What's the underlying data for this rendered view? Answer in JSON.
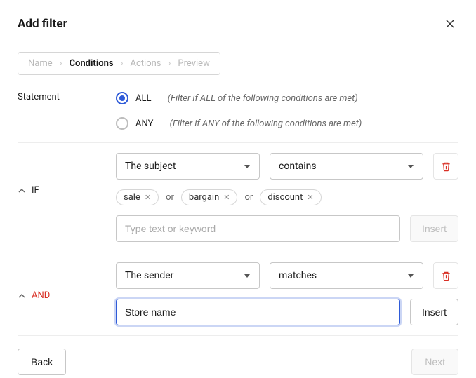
{
  "header": {
    "title": "Add filter"
  },
  "breadcrumb": {
    "steps": [
      "Name",
      "Conditions",
      "Actions",
      "Preview"
    ],
    "active_index": 1
  },
  "statement": {
    "label": "Statement",
    "options": [
      {
        "value": "ALL",
        "desc": "(Filter if ALL of the following conditions are met)",
        "selected": true
      },
      {
        "value": "ANY",
        "desc": "(Filter if ANY of the following conditions are met)",
        "selected": false
      }
    ]
  },
  "conditions": [
    {
      "label": "IF",
      "field": "The subject",
      "operator": "contains",
      "tags": [
        "sale",
        "bargain",
        "discount"
      ],
      "tag_join": "or",
      "input_value": "",
      "input_placeholder": "Type text or keyword",
      "insert_label": "Insert",
      "insert_enabled": false
    },
    {
      "label": "AND",
      "field": "The sender",
      "operator": "matches",
      "input_value": "Store name",
      "insert_label": "Insert",
      "insert_enabled": true,
      "input_focused": true
    }
  ],
  "footer": {
    "back": "Back",
    "next": "Next",
    "next_enabled": false
  }
}
